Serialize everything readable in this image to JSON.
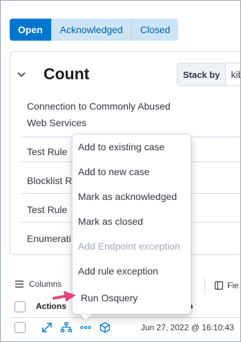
{
  "status_tabs": [
    {
      "label": "Open",
      "active": true
    },
    {
      "label": "Acknowledged",
      "active": false
    },
    {
      "label": "Closed",
      "active": false
    }
  ],
  "count_panel": {
    "title": "Count",
    "stack_by_label": "Stack by",
    "stack_by_value": "kib",
    "rules": [
      "Connection to Commonly Abused",
      "Web Services",
      "Test Rule",
      "Blocklist R",
      "Test Rule",
      "Enumerati"
    ]
  },
  "table": {
    "columns_label": "Columns",
    "fields_label": "Fie",
    "header_actions": "Actions",
    "header_timestamp": "imp",
    "row_timestamp": "Jun 27, 2022 @ 16:10:43"
  },
  "context_menu": {
    "items": [
      {
        "label": "Add to existing case",
        "disabled": false
      },
      {
        "label": "Add to new case",
        "disabled": false
      },
      {
        "label": "Mark as acknowledged",
        "disabled": false
      },
      {
        "label": "Mark as closed",
        "disabled": false
      },
      {
        "label": "Add Endpoint exception",
        "disabled": true
      },
      {
        "label": "Add rule exception",
        "disabled": false
      },
      {
        "label": "Run Osquery",
        "disabled": false
      }
    ]
  },
  "colors": {
    "primary": "#0077cc",
    "tab_bg": "#cce4f5",
    "arrow": "#e0457b"
  },
  "icons": [
    "chevron-down-icon",
    "columns-icon",
    "fields-icon",
    "expand-icon",
    "analyze-event-icon",
    "more-actions-icon",
    "cube-icon",
    "pointer-arrow-icon"
  ]
}
